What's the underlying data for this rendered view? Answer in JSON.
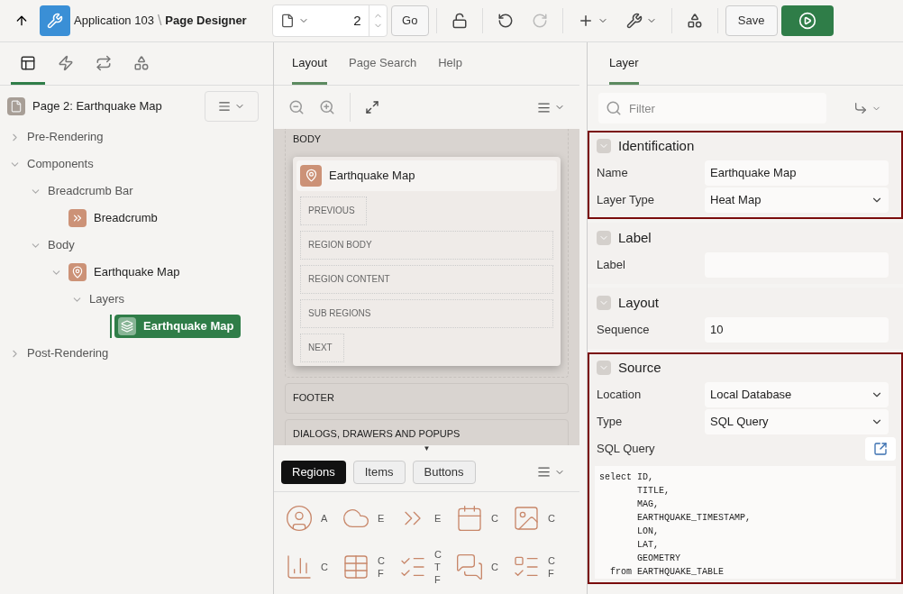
{
  "toolbar": {
    "app": "Application 103",
    "separator": "\\",
    "title": "Page Designer",
    "page_number": "2",
    "go": "Go",
    "save": "Save",
    "redo_disabled": true
  },
  "left": {
    "tabs": [
      {
        "kind": "rendering",
        "selected": true
      },
      {
        "kind": "dynamic-actions",
        "selected": false
      },
      {
        "kind": "processing",
        "selected": false
      },
      {
        "kind": "shared",
        "selected": false
      }
    ],
    "page": {
      "title": "Page 2: Earthquake Map"
    },
    "tree": [
      {
        "label": "Pre-Rendering",
        "expanded": false,
        "selected": false
      },
      {
        "label": "Components",
        "expanded": true,
        "selected": false,
        "children": [
          {
            "label": "Breadcrumb Bar",
            "expanded": true,
            "selected": false,
            "children": [
              {
                "label": "Breadcrumb",
                "kind": "breadcrumb",
                "selected": false
              }
            ]
          },
          {
            "label": "Body",
            "expanded": true,
            "selected": false,
            "children": [
              {
                "label": "Earthquake Map",
                "kind": "map",
                "expanded": true,
                "selected": false,
                "children": [
                  {
                    "label": "Layers",
                    "expanded": true,
                    "selected": false,
                    "children": [
                      {
                        "label": "Earthquake Map",
                        "kind": "layer",
                        "selected": true
                      }
                    ]
                  }
                ]
              }
            ]
          }
        ]
      },
      {
        "label": "Post-Rendering",
        "expanded": false,
        "selected": false
      }
    ]
  },
  "middle": {
    "tabs": [
      {
        "label": "Layout",
        "selected": true
      },
      {
        "label": "Page Search",
        "selected": false
      },
      {
        "label": "Help",
        "selected": false
      }
    ],
    "body_label": "BODY",
    "region_title": "Earthquake Map",
    "slots": [
      {
        "label": "PREVIOUS",
        "wide": false
      },
      {
        "label": "REGION BODY",
        "wide": true
      },
      {
        "label": "REGION CONTENT",
        "wide": true
      },
      {
        "label": "SUB REGIONS",
        "wide": true
      },
      {
        "label": "NEXT",
        "wide": false
      }
    ],
    "sections": [
      "FOOTER",
      "DIALOGS, DRAWERS AND POPUPS"
    ],
    "splitter": "▼",
    "gallery_tabs": [
      {
        "label": "Regions",
        "selected": true
      },
      {
        "label": "Items",
        "selected": false
      },
      {
        "label": "Buttons",
        "selected": false
      }
    ],
    "gallery": [
      {
        "kind": "avatar",
        "lines": [
          "A"
        ]
      },
      {
        "kind": "badge",
        "lines": [
          "E"
        ]
      },
      {
        "kind": "breadcrumb",
        "lines": [
          "E"
        ]
      },
      {
        "kind": "calendar",
        "lines": [
          "C"
        ]
      },
      {
        "kind": "card",
        "lines": [
          "C"
        ]
      },
      {
        "kind": "chart",
        "lines": [
          "C"
        ]
      },
      {
        "kind": "grid",
        "lines": [
          "C",
          "F"
        ]
      },
      {
        "kind": "checklist",
        "lines": [
          "C",
          "T",
          "F"
        ]
      },
      {
        "kind": "comments",
        "lines": [
          "C"
        ]
      },
      {
        "kind": "list",
        "lines": [
          "C",
          "F"
        ]
      }
    ]
  },
  "right": {
    "tab": "Layer",
    "filter": {
      "placeholder": "Filter"
    },
    "groups": [
      {
        "title": "Identification",
        "highlighted": true,
        "fields": [
          {
            "label": "Name",
            "kind": "text",
            "value": "Earthquake Map"
          },
          {
            "label": "Layer Type",
            "kind": "select",
            "value": "Heat Map"
          }
        ]
      },
      {
        "title": "Label",
        "highlighted": false,
        "fields": [
          {
            "label": "Label",
            "kind": "text"
          }
        ]
      },
      {
        "title": "Layout",
        "highlighted": false,
        "fields": [
          {
            "label": "Sequence",
            "kind": "text",
            "value": "10"
          }
        ]
      },
      {
        "title": "Source",
        "highlighted": true,
        "fields": [
          {
            "label": "Location",
            "kind": "select",
            "value": "Local Database"
          },
          {
            "label": "Type",
            "kind": "select",
            "value": "SQL Query"
          },
          {
            "label": "SQL Query",
            "kind": "code",
            "lines": [
              "select ID,",
              "       TITLE,",
              "       MAG,",
              "       EARTHQUAKE_TIMESTAMP,",
              "       LON,",
              "       LAT,",
              "       GEOMETRY",
              "  from EARTHQUAKE_TABLE"
            ]
          }
        ]
      }
    ]
  }
}
